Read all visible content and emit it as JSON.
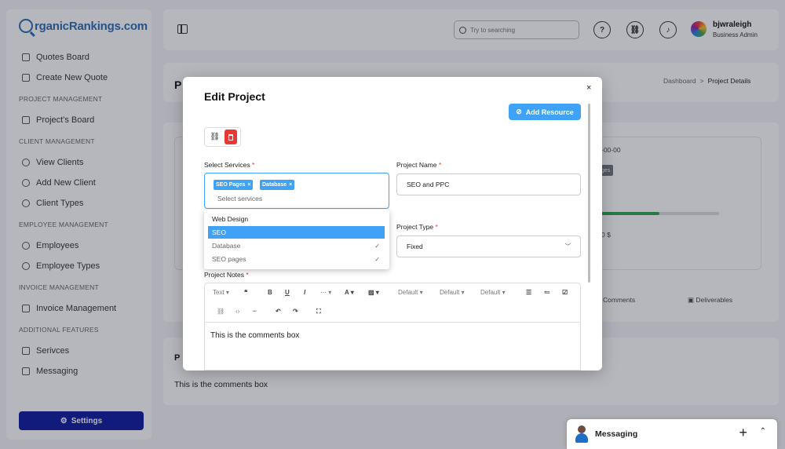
{
  "brand": {
    "logo_text": "rganicRankings.com"
  },
  "sidebar": {
    "items_top": [
      {
        "label": "Quotes Board",
        "icon": "board-icon"
      },
      {
        "label": "Create New Quote",
        "icon": "document-icon"
      }
    ],
    "sections": [
      {
        "title": "PROJECT MANAGEMENT",
        "items": [
          {
            "label": "Project's Board"
          }
        ]
      },
      {
        "title": "CLIENT MANAGEMENT",
        "items": [
          {
            "label": "View Clients"
          },
          {
            "label": "Add New Client"
          },
          {
            "label": "Client Types"
          }
        ]
      },
      {
        "title": "EMPLOYEE MANAGEMENT",
        "items": [
          {
            "label": "Employees"
          },
          {
            "label": "Employee Types"
          }
        ]
      },
      {
        "title": "INVOICE MANAGEMENT",
        "items": [
          {
            "label": "Invoice Management"
          }
        ]
      },
      {
        "title": "ADDITIONAL FEATURES",
        "items": [
          {
            "label": "Serivces"
          },
          {
            "label": "Messaging"
          }
        ]
      }
    ],
    "settings_label": "Settings"
  },
  "header": {
    "search_placeholder": "Try to searching",
    "user_name": "bjwraleigh",
    "user_role": "Business Admin"
  },
  "breadcrumb": {
    "home": "Dashboard",
    "separator": ">",
    "current": "Project Details"
  },
  "background": {
    "page_title_initial": "P",
    "date_fragment": "-00-00",
    "tag_fragment": "ages",
    "amount_fragment": "0 $",
    "comments_tab": "Comments",
    "deliverables_tab": "Deliverables",
    "section_initial": "P",
    "comments_text": "This is the comments box",
    "progress_fraction": 0.5
  },
  "messaging": {
    "title": "Messaging"
  },
  "modal": {
    "title": "Edit Project",
    "close_glyph": "×",
    "add_resource_label": "Add Resource",
    "select_services": {
      "label": "Select Services",
      "required": "*",
      "chips": [
        "SEO Pages",
        "Database"
      ],
      "placeholder": "Select services",
      "options": [
        {
          "label": "Web Design",
          "state": "normal"
        },
        {
          "label": "SEO",
          "state": "highlighted"
        },
        {
          "label": "Database",
          "state": "selected"
        },
        {
          "label": "SEO pages",
          "state": "selected"
        }
      ]
    },
    "project_name": {
      "label": "Project Name",
      "required": "*",
      "value": "SEO and PPC"
    },
    "project_type": {
      "label": "Project Type",
      "required": "*",
      "value": "Fixed"
    },
    "project_notes": {
      "label": "Project Notes",
      "required": "*",
      "toolbar": {
        "text_label": "Text",
        "default_1": "Default",
        "default_2": "Default",
        "default_3": "Default"
      },
      "content": "This is the comments box"
    }
  },
  "colors": {
    "accent": "#3fa2f7",
    "settings_button": "#0b1aa0",
    "delete": "#e53935",
    "progress": "#2ea44f"
  }
}
